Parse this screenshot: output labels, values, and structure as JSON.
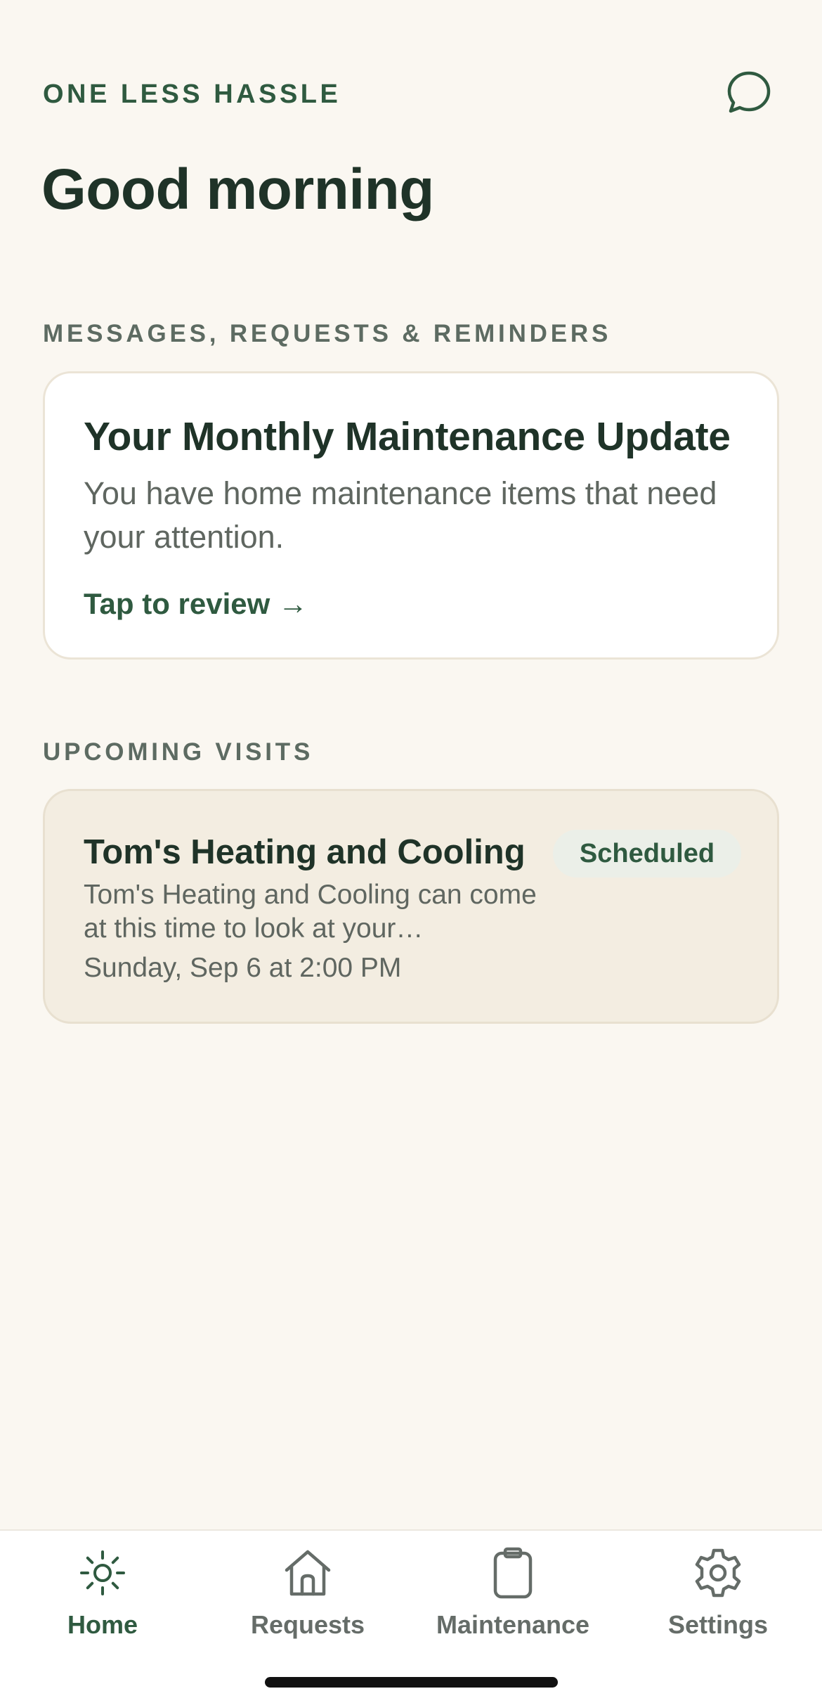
{
  "header": {
    "brand": "ONE LESS HASSLE",
    "greeting": "Good morning",
    "chat_icon": "chat-bubble-icon"
  },
  "messages_section": {
    "label": "MESSAGES, REQUESTS & REMINDERS",
    "card": {
      "title": "Your Monthly Maintenance Update",
      "body": "You have home maintenance items that need your attention.",
      "link": "Tap to review →"
    }
  },
  "visits_section": {
    "label": "UPCOMING VISITS",
    "visits": [
      {
        "title": "Tom's Heating and Cooling",
        "description": "Tom's Heating and Cooling can come at this time to look at your…",
        "date": "Sunday, Sep 6 at 2:00 PM",
        "status": "Scheduled"
      }
    ]
  },
  "tab_bar": {
    "tabs": [
      {
        "label": "Home",
        "icon": "sun-icon",
        "active": true
      },
      {
        "label": "Requests",
        "icon": "house-icon",
        "active": false
      },
      {
        "label": "Maintenance",
        "icon": "clipboard-icon",
        "active": false
      },
      {
        "label": "Settings",
        "icon": "gear-icon",
        "active": false
      }
    ]
  },
  "colors": {
    "background": "#faf7f1",
    "accent_green": "#2f5a40",
    "heading": "#1f3328",
    "muted_text": "#5f6660",
    "visit_card_bg": "#f3ede1",
    "badge_bg": "#ebefe8"
  }
}
